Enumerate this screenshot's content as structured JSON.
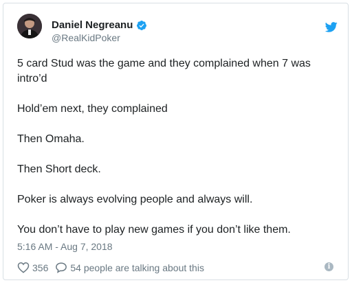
{
  "author": {
    "name": "Daniel Negreanu",
    "handle": "@RealKidPoker",
    "verified": true
  },
  "tweet": {
    "paragraphs": [
      "5 card Stud was the game and they complained when 7 was intro’d",
      "Hold’em next, they complained",
      "Then Omaha.",
      "Then Short deck.",
      "Poker is always evolving people and always will.",
      "You don’t have to play new games if you don’t like them."
    ],
    "timestamp": "5:16 AM - Aug 7, 2018"
  },
  "actions": {
    "likes": "356",
    "replies": "54 people are talking about this"
  },
  "icons": {
    "avatar": "avatar-photo",
    "verified": "verified-badge-icon",
    "brand": "twitter-bird-icon",
    "like": "heart-icon",
    "reply": "reply-bubble-icon",
    "info": "info-icon"
  },
  "colors": {
    "brand": "#1da1f2",
    "text": "#1c2022",
    "muted": "#697882",
    "border": "#d8dfe4"
  }
}
